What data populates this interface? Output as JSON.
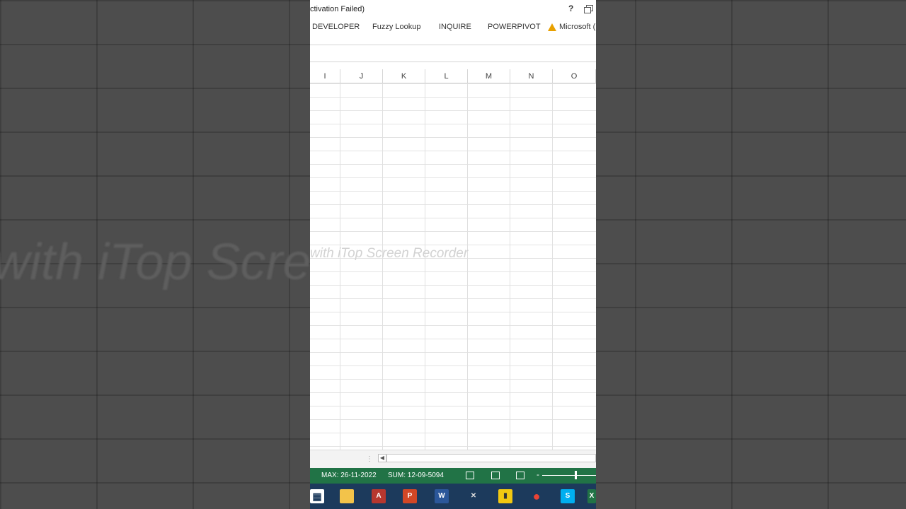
{
  "window": {
    "title": "ctivation Failed)",
    "help_label": "?"
  },
  "ribbon": {
    "tabs": [
      "DEVELOPER",
      "Fuzzy Lookup",
      "INQUIRE",
      "POWERPIVOT",
      "Microsoft ("
    ]
  },
  "grid": {
    "columns": [
      "I",
      "J",
      "K",
      "L",
      "M",
      "N",
      "O"
    ]
  },
  "watermark": {
    "text": "with iTop Screen Recorder",
    "background_text": "with iTop Scre"
  },
  "scrollbar": {
    "dots": "⋮",
    "left_arrow": "◀"
  },
  "status_bar": {
    "max": "MAX: 26-11-2022",
    "sum": "SUM: 12-09-5094",
    "zoom_minus": "-"
  },
  "taskbar": {
    "icons": [
      {
        "name": "store-icon",
        "glyph": "▦",
        "color": "#ffffff"
      },
      {
        "name": "file-explorer-icon",
        "glyph": "",
        "color": "#f3c34a"
      },
      {
        "name": "access-icon",
        "glyph": "A",
        "color": "#b7372f"
      },
      {
        "name": "powerpoint-icon",
        "glyph": "P",
        "color": "#d24726"
      },
      {
        "name": "word-icon",
        "glyph": "W",
        "color": "#2b579a"
      },
      {
        "name": "tools-icon",
        "glyph": "✕",
        "color": "#1c3a5c"
      },
      {
        "name": "power-bi-icon",
        "glyph": "▮",
        "color": "#f2c811"
      },
      {
        "name": "chrome-icon",
        "glyph": "●",
        "color": "#1c3a5c"
      },
      {
        "name": "skype-icon",
        "glyph": "S",
        "color": "#00aff0"
      },
      {
        "name": "excel-icon",
        "glyph": "X",
        "color": "#217346"
      }
    ]
  },
  "colors": {
    "status_green": "#217346",
    "taskbar": "#1c3a5c"
  }
}
